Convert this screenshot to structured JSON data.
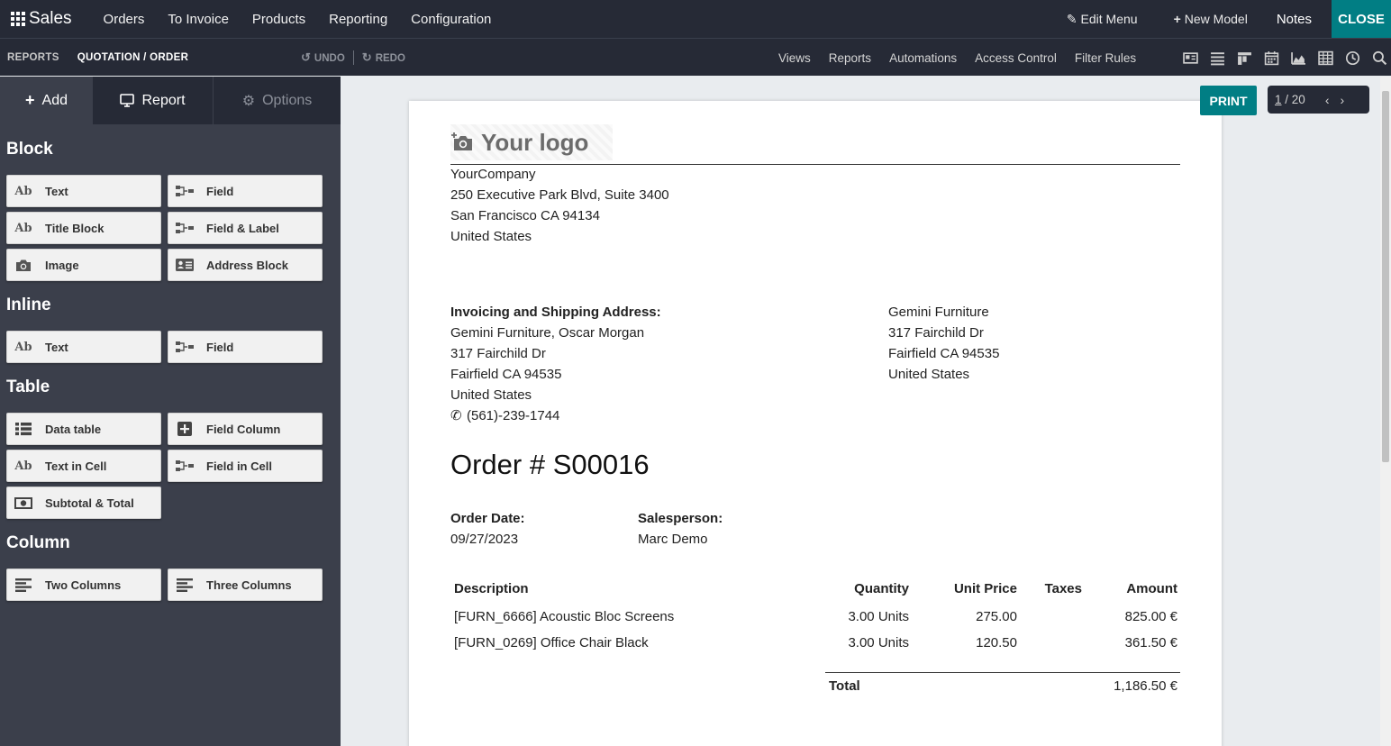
{
  "topbar": {
    "app_name": "Sales",
    "menu": [
      "Orders",
      "To Invoice",
      "Products",
      "Reporting",
      "Configuration"
    ],
    "edit_menu": "Edit Menu",
    "new_model": "New Model",
    "notes": "Notes",
    "close": "CLOSE"
  },
  "subbar": {
    "crumb1": "REPORTS",
    "crumb2": "QUOTATION / ORDER",
    "undo": "UNDO",
    "redo": "REDO",
    "links": [
      "Views",
      "Reports",
      "Automations",
      "Access Control",
      "Filter Rules"
    ],
    "view_icons": [
      "form-view-icon",
      "list-view-icon",
      "kanban-view-icon",
      "calendar-view-icon",
      "graph-view-icon",
      "pivot-view-icon",
      "activity-view-icon",
      "search-view-icon"
    ]
  },
  "sidebar": {
    "tabs": {
      "add": "Add",
      "report": "Report",
      "options": "Options"
    },
    "sections": {
      "block": "Block",
      "inline": "Inline",
      "table": "Table",
      "column": "Column"
    },
    "block_items": [
      {
        "label": "Text",
        "icon": "text-ab-icon"
      },
      {
        "label": "Field",
        "icon": "field-icon"
      },
      {
        "label": "Title Block",
        "icon": "text-ab-icon"
      },
      {
        "label": "Field & Label",
        "icon": "field-icon"
      },
      {
        "label": "Image",
        "icon": "camera-icon"
      },
      {
        "label": "Address Block",
        "icon": "address-card-icon"
      }
    ],
    "inline_items": [
      {
        "label": "Text",
        "icon": "text-ab-icon"
      },
      {
        "label": "Field",
        "icon": "field-icon"
      }
    ],
    "table_items": [
      {
        "label": "Data table",
        "icon": "list-icon"
      },
      {
        "label": "Field Column",
        "icon": "plus-square-icon"
      },
      {
        "label": "Text in Cell",
        "icon": "text-ab-icon"
      },
      {
        "label": "Field in Cell",
        "icon": "field-icon"
      },
      {
        "label": "Subtotal & Total",
        "icon": "money-icon"
      }
    ],
    "column_items": [
      {
        "label": "Two Columns",
        "icon": "align-left-icon"
      },
      {
        "label": "Three Columns",
        "icon": "align-left-icon"
      }
    ]
  },
  "preview": {
    "print": "PRINT",
    "pager_current": "1",
    "pager_total": "20"
  },
  "document": {
    "logo_text": "Your logo",
    "company": [
      "YourCompany",
      "250 Executive Park Blvd, Suite 3400",
      "San Francisco CA 94134",
      "United States"
    ],
    "address_label": "Invoicing and Shipping Address:",
    "address_lines": [
      "Gemini Furniture, Oscar Morgan",
      "317 Fairchild Dr",
      "Fairfield CA 94535",
      "United States"
    ],
    "phone": "(561)-239-1744",
    "partner_lines": [
      "Gemini Furniture",
      "317 Fairchild Dr",
      "Fairfield CA 94535",
      "United States"
    ],
    "order_title": "Order # S00016",
    "order_date_label": "Order Date:",
    "order_date": "09/27/2023",
    "salesperson_label": "Salesperson:",
    "salesperson": "Marc Demo",
    "table_headers": [
      "Description",
      "Quantity",
      "Unit Price",
      "Taxes",
      "Amount"
    ],
    "rows": [
      {
        "description": "[FURN_6666] Acoustic Bloc Screens",
        "quantity": "3.00 Units",
        "unit_price": "275.00",
        "taxes": "",
        "amount": "825.00 €"
      },
      {
        "description": "[FURN_0269] Office Chair Black",
        "quantity": "3.00 Units",
        "unit_price": "120.50",
        "taxes": "",
        "amount": "361.50 €"
      }
    ],
    "total_label": "Total",
    "total_value": "1,186.50 €"
  },
  "colors": {
    "navbar": "#262a36",
    "sidebar": "#3b3f4b",
    "accent": "#017e84"
  }
}
